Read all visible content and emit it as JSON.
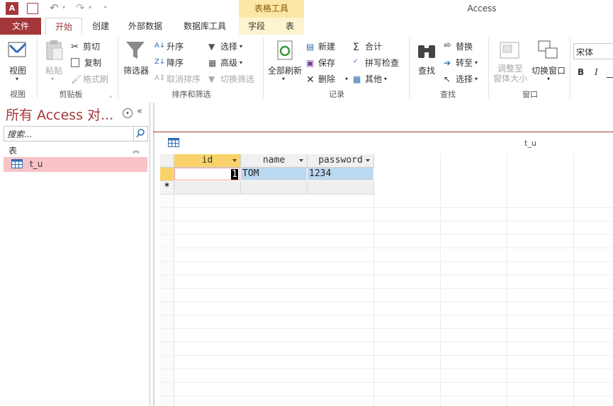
{
  "titlebar": {
    "contextual_header": "表格工具",
    "app_title": "Access"
  },
  "tabs": [
    {
      "label": "文件"
    },
    {
      "label": "开始"
    },
    {
      "label": "创建"
    },
    {
      "label": "外部数据"
    },
    {
      "label": "数据库工具"
    },
    {
      "label": "字段"
    },
    {
      "label": "表"
    }
  ],
  "ribbon": {
    "view": {
      "label": "视图",
      "group": "视图"
    },
    "clipboard": {
      "paste": "粘贴",
      "cut": "剪切",
      "copy": "复制",
      "format_painter": "格式刷",
      "group": "剪贴板"
    },
    "sort_filter": {
      "filter": "筛选器",
      "ascending": "升序",
      "descending": "降序",
      "remove_sort": "取消排序",
      "selection": "选择",
      "advanced": "高级",
      "toggle_filter": "切换筛选",
      "group": "排序和筛选"
    },
    "records": {
      "refresh_all": "全部刷新",
      "new": "新建",
      "save": "保存",
      "delete": "删除",
      "totals": "合计",
      "spelling": "拼写检查",
      "more": "其他",
      "group": "记录"
    },
    "find": {
      "find": "查找",
      "replace": "替换",
      "goto": "转至",
      "select": "选择",
      "group": "查找"
    },
    "window": {
      "size_to_fit_1": "调整至",
      "size_to_fit_2": "窗体大小",
      "switch_windows": "切换窗口",
      "group": "窗口"
    },
    "text": {
      "font": "宋体",
      "bold": "B",
      "italic": "I"
    }
  },
  "nav": {
    "title": "所有 Access 对...",
    "search_placeholder": "搜索...",
    "group": "表",
    "items": [
      {
        "label": "t_u"
      }
    ]
  },
  "document": {
    "tab_title": "t_u"
  },
  "table": {
    "columns": [
      "id",
      "name",
      "password"
    ],
    "rows": [
      [
        "1",
        "TOM",
        "1234"
      ]
    ],
    "new_row_marker": "*"
  },
  "colors": {
    "accent": "#a4373a",
    "contextual": "#fbe7a6",
    "selected_nav": "#f7c3c6",
    "header_active": "#f9d36a"
  }
}
